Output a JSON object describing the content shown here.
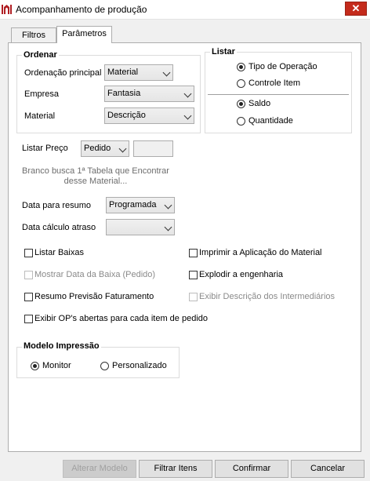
{
  "window": {
    "title": "Acompanhamento de produção",
    "close_glyph": "✕",
    "accent": "#c42b1c"
  },
  "tabs": [
    {
      "label": "Filtros"
    },
    {
      "label": "Parâmetros"
    }
  ],
  "ordenar": {
    "legend": "Ordenar",
    "ordenacao_label": "Ordenação principal",
    "ordenacao_value": "Material",
    "empresa_label": "Empresa",
    "empresa_value": "Fantasia",
    "material_label": "Material",
    "material_value": "Descrição"
  },
  "listar": {
    "legend": "Listar",
    "tipo_operacao": "Tipo de Operação",
    "controle_item": "Controle Item",
    "saldo": "Saldo",
    "quantidade": "Quantidade"
  },
  "preco": {
    "label": "Listar Preço",
    "value": "Pedido",
    "hint_line1": "Branco busca 1ª Tabela que Encontrar",
    "hint_line2": "desse Material..."
  },
  "data_resumo": {
    "label": "Data para resumo",
    "value": "Programada"
  },
  "data_calculo": {
    "label": "Data cálculo atraso",
    "value": ""
  },
  "checks": {
    "listar_baixas": "Listar Baixas",
    "mostrar_data_baixa": "Mostrar Data da Baixa (Pedido)",
    "resumo_previsao": "Resumo Previsão Faturamento",
    "exibir_ops": "Exibir OP's abertas para cada item de pedido",
    "imprimir_aplicacao": "Imprimir a Aplicação do Material",
    "explodir_engenharia": "Explodir a engenharia",
    "exibir_descricao": "Exibir Descrição dos Intermediários"
  },
  "modelo": {
    "legend": "Modelo Impressão",
    "monitor": "Monitor",
    "personalizado": "Personalizado"
  },
  "buttons": {
    "alterar_modelo": "Alterar Modelo",
    "filtrar_itens": "Filtrar Itens",
    "confirmar": "Confirmar",
    "cancelar": "Cancelar"
  }
}
